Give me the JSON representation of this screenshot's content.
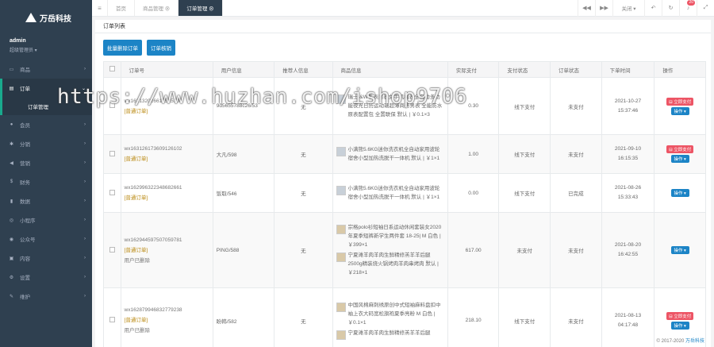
{
  "sidebar": {
    "brand": "万岳科技",
    "user": "admin",
    "role": "超级管理员 ▾",
    "items": [
      {
        "icon": "monitor-icon",
        "glyph": "▭",
        "label": "商品"
      },
      {
        "icon": "order-icon",
        "glyph": "▤",
        "label": "订单"
      },
      {
        "icon": "user-icon",
        "glyph": "●",
        "label": "会员"
      },
      {
        "icon": "share-icon",
        "glyph": "✱",
        "label": "分销"
      },
      {
        "icon": "megaphone-icon",
        "glyph": "◀",
        "label": "营销"
      },
      {
        "icon": "finance-icon",
        "glyph": "$",
        "label": "财务"
      },
      {
        "icon": "chart-icon",
        "glyph": "▮",
        "label": "数据"
      },
      {
        "icon": "miniapp-icon",
        "glyph": "◎",
        "label": "小程序"
      },
      {
        "icon": "wechat-icon",
        "glyph": "◉",
        "label": "公众号"
      },
      {
        "icon": "content-icon",
        "glyph": "▣",
        "label": "内容"
      },
      {
        "icon": "settings-icon",
        "glyph": "⚙",
        "label": "设置"
      },
      {
        "icon": "maintain-icon",
        "glyph": "✎",
        "label": "维护"
      }
    ],
    "sub_item": "订单管理"
  },
  "topbar": {
    "tabs": [
      {
        "label": "首页"
      },
      {
        "label": "商品管理 ⊗"
      },
      {
        "label": "订单管理 ⊗"
      }
    ],
    "close_label": "关闭 ▾",
    "badge": "20"
  },
  "panel": {
    "title": "订单列表",
    "buttons": [
      "批量删除订单",
      "订单核销"
    ]
  },
  "table": {
    "headers": [
      "",
      "订单号",
      "用户信息",
      "推荐人信息",
      "商品信息",
      "实际支付",
      "支付状态",
      "订单状态",
      "下单时间",
      "操作"
    ],
    "rows": [
      {
        "order_no": "wx163132026612525100",
        "order_type": "[普通订单]",
        "user": "9d5655788c26/53",
        "referrer": "无",
        "goods": [
          "瑞士I&W手表男表女手机械表全自动多功能夜光日历运动瑞超薄商务男表 全能防水原表配置包 全置联保 默认 | ￥0.1×3"
        ],
        "amount": "0.30",
        "pay_status": "线下支付",
        "order_status": "未支付",
        "date": "2021-10-27",
        "time": "15:37:46",
        "pay_btn": "⊟ 立即支付",
        "op_btn": "操作 ▾"
      },
      {
        "order_no": "wx163126173609126102",
        "order_type": "[普通订单]",
        "user": "大凡/598",
        "referrer": "无",
        "goods": [
          "小满熊5.6KG迷你洗衣机全自动家用波轮宿舍小型加热洗脱干一体机 默认 | ￥1×1"
        ],
        "amount": "1.00",
        "pay_status": "线下支付",
        "order_status": "未支付",
        "date": "2021-09-10",
        "time": "16:15:35",
        "pay_btn": "⊟ 立即支付",
        "op_btn": "操作 ▾"
      },
      {
        "order_no": "wx162996322348682661",
        "order_type": "[普通订单]",
        "user": "饭取/546",
        "referrer": "无",
        "goods": [
          "小满熊5.6KG迷你洗衣机全自动家用波轮宿舍小型加热洗脱干一体机 默认 | ￥1×1"
        ],
        "amount": "0.00",
        "pay_status": "线下支付",
        "order_status": "已完成",
        "date": "2021-08-26",
        "time": "15:33:43",
        "pay_btn": "",
        "op_btn": "操作 ▾"
      },
      {
        "order_no": "wx162944597507059781",
        "order_type": "[普通订单]",
        "order_note": "用户已删除",
        "user": "PING/588",
        "referrer": "无",
        "goods": [
          "宗格polo衫短袖日系运动休闲套装女2020年夏季短裤新学生两件套 18-25| M 白色 | ￥399×1",
          "宁夏滩羊肉羊肉生鲜精修羔羊羊后腿2500g精装烧火锅烤肉羊肉串烤肉 默认 | ￥218×1"
        ],
        "amount": "617.00",
        "pay_status": "未支付",
        "order_status": "未支付",
        "date": "2021-08-20",
        "time": "16:42:55",
        "pay_btn": "",
        "op_btn": "操作 ▾"
      },
      {
        "order_no": "wx162879946832779238",
        "order_type": "[普通订单]",
        "order_note": "用户已删除",
        "user": "盼韩/582",
        "referrer": "无",
        "goods": [
          "中国风棉麻刺绣原创中式短袖麻料盘扣中袖上衣大码宽松旗袍夏季亮粉 M 白色 | ￥0.1×1",
          "宁夏滩羊肉羊肉生鲜精修羔羊羊后腿"
        ],
        "amount": "218.10",
        "pay_status": "线下支付",
        "order_status": "未支付",
        "date": "2021-08-13",
        "time": "04:17:48",
        "pay_btn": "⊟ 立即支付",
        "op_btn": "操作 ▾"
      }
    ]
  },
  "footer": {
    "copyright": "© 2017-2020",
    "brand": "万岳科技"
  },
  "watermark": "https://www.huzhan.com/ishop9706"
}
